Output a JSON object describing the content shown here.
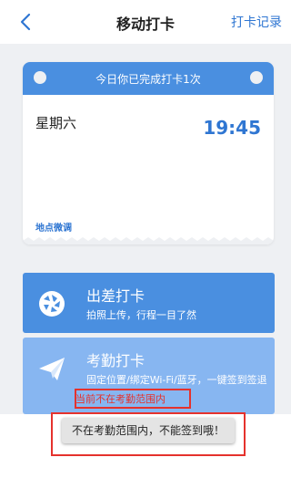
{
  "nav": {
    "title": "移动打卡",
    "record_label": "打卡记录",
    "back_icon": "chevron-left-icon"
  },
  "card": {
    "header_text": "今日你已完成打卡1次",
    "weekday": "星期六",
    "time": "19:45",
    "adjust_label": "地点微调"
  },
  "options": {
    "trip": {
      "title": "出差打卡",
      "subtitle": "拍照上传，行程一目了然",
      "icon": "camera-shutter-icon"
    },
    "attendance": {
      "title": "考勤打卡",
      "subtitle": "固定位置/绑定Wi-Fi/蓝牙，一键签到签退",
      "status": "当前不在考勤范围内",
      "icon": "paper-plane-icon"
    }
  },
  "toast": {
    "message": "不在考勤范围内，不能签到哦！"
  },
  "colors": {
    "brand_blue": "#4a8fe0",
    "light_blue": "#87b6f1",
    "accent_text": "#2f76d2",
    "alert_red": "#e5322d"
  }
}
